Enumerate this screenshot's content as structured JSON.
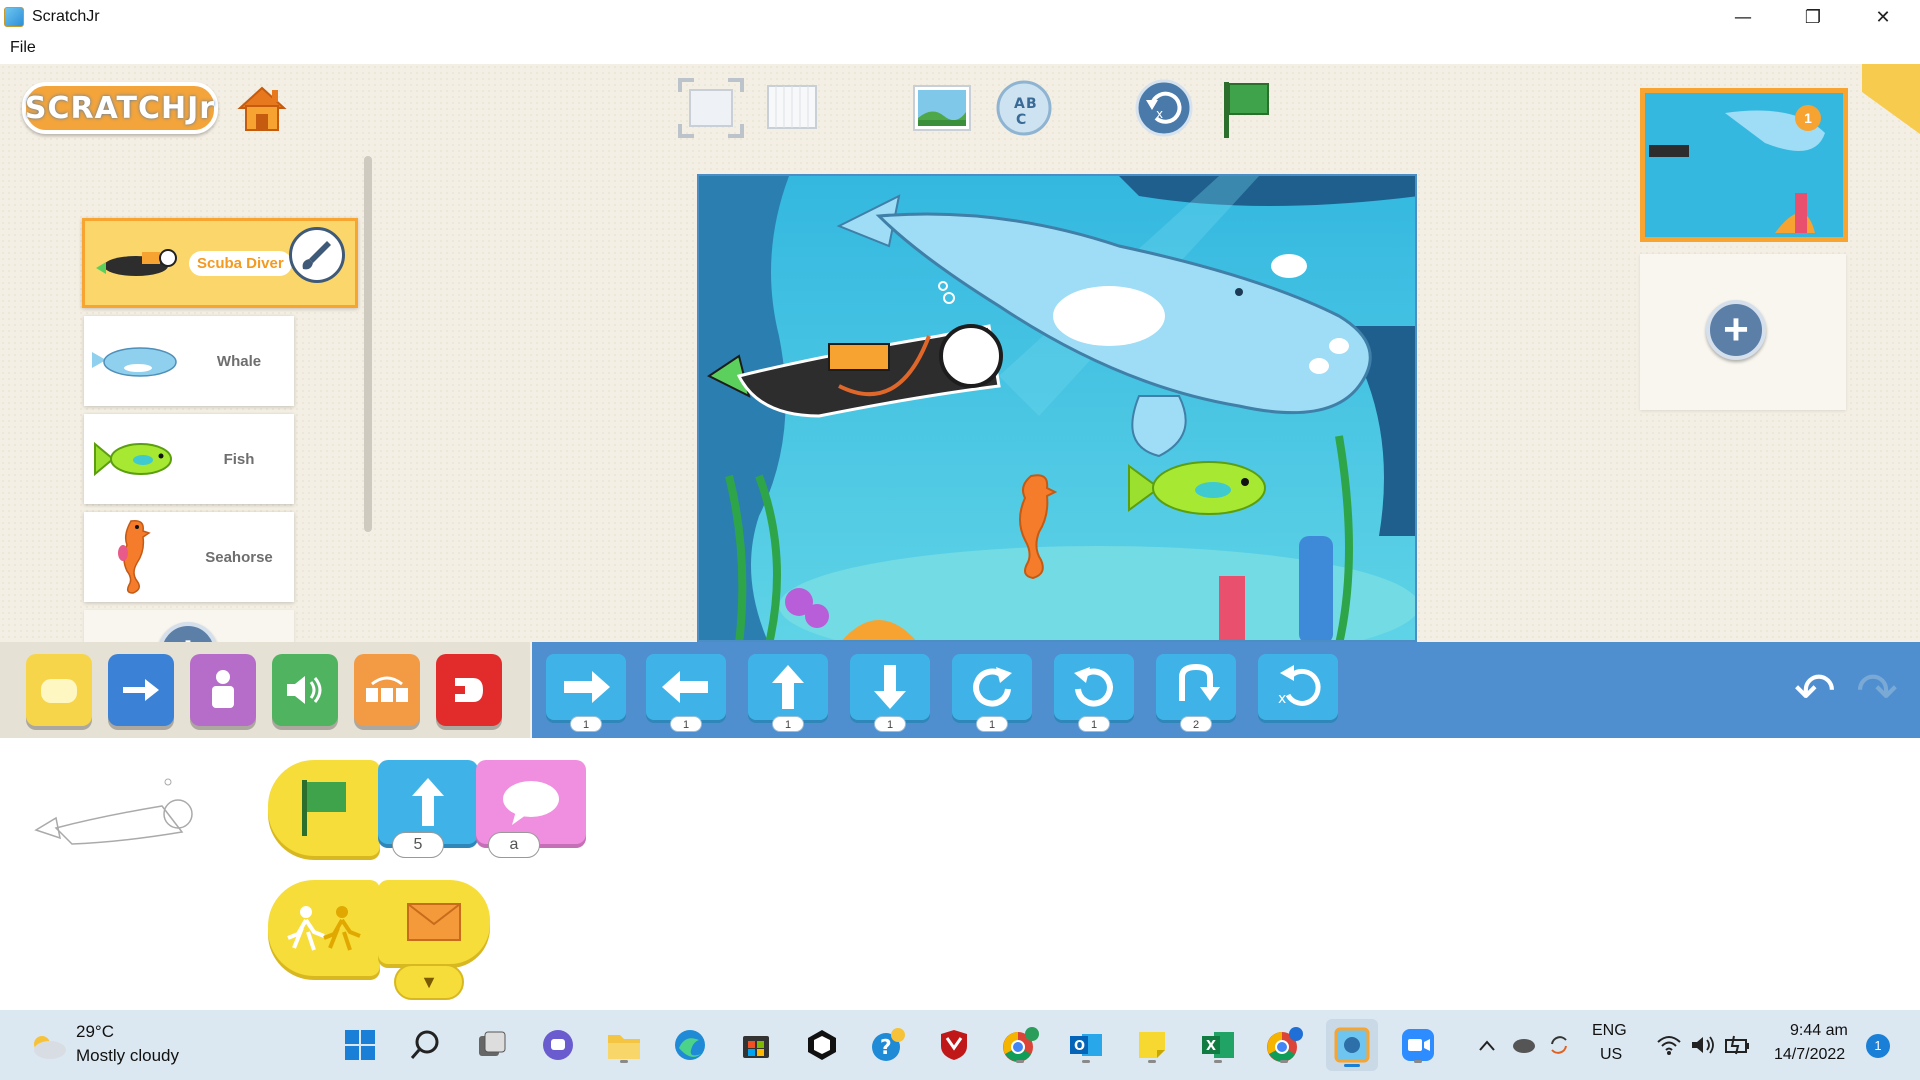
{
  "window": {
    "title": "ScratchJr",
    "minimize_glyph": "—",
    "restore_glyph": "❐",
    "close_glyph": "✕"
  },
  "menu": {
    "file": "File"
  },
  "logo": {
    "text": "SCRATCHJr"
  },
  "toolbar": {
    "fullscreen_icon": "fullscreen-icon",
    "grid_icon": "grid-icon",
    "background_icon": "background-image-icon",
    "text_icon": "text-abc-icon",
    "reset_icon": "reset-characters-icon",
    "green_flag_icon": "green-flag-icon"
  },
  "sprites": [
    {
      "name": "Scuba Diver",
      "selected": true
    },
    {
      "name": "Whale",
      "selected": false
    },
    {
      "name": "Fish",
      "selected": false
    },
    {
      "name": "Seahorse",
      "selected": false
    }
  ],
  "sprite_add": "+",
  "pages": {
    "page_number": "1",
    "add": "+"
  },
  "categories": [
    {
      "name": "triggering",
      "color": "#f6d54a"
    },
    {
      "name": "motion",
      "color": "#3b82d6"
    },
    {
      "name": "looks",
      "color": "#b66cc9"
    },
    {
      "name": "sound",
      "color": "#4fb35f"
    },
    {
      "name": "control",
      "color": "#f29a44"
    },
    {
      "name": "end",
      "color": "#e22c2c"
    }
  ],
  "motion_blocks": [
    {
      "name": "move-right",
      "value": "1"
    },
    {
      "name": "move-left",
      "value": "1"
    },
    {
      "name": "move-up",
      "value": "1"
    },
    {
      "name": "move-down",
      "value": "1"
    },
    {
      "name": "turn-right",
      "value": "1"
    },
    {
      "name": "turn-left",
      "value": "1"
    },
    {
      "name": "hop",
      "value": "2"
    },
    {
      "name": "go-home",
      "value": ""
    }
  ],
  "palette_nav": {
    "undo": "↶",
    "redo": "↷"
  },
  "script": {
    "row1": {
      "up_value": "5",
      "say_value": "a"
    },
    "row2": {
      "message": "▼"
    }
  },
  "taskbar": {
    "weather_temp": "29°C",
    "weather_desc": "Mostly cloudy",
    "lang_1": "ENG",
    "lang_2": "US",
    "time": "9:44 am",
    "date": "14/7/2022",
    "notification_count": "1"
  }
}
